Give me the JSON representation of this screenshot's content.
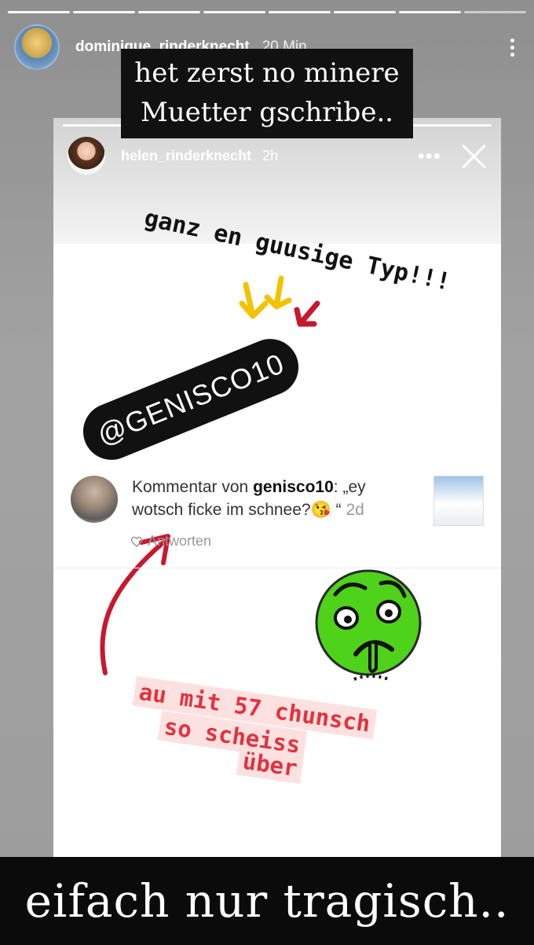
{
  "outer_story": {
    "username": "dominique_rinderknecht",
    "time": "20 Min.",
    "caption_top": "het zerst no minere Muetter gschribe..",
    "caption_bottom": "eifach nur tragisch.."
  },
  "inner_story": {
    "username": "helen_rinderknecht",
    "time": "2h",
    "more": "•••",
    "handwritten_top": "ganz en guusige Typ!!!",
    "tag": "@GENISCO10",
    "comment_prefix": "Kommentar von ",
    "comment_user": "genisco10",
    "comment_body_1": ": „ey",
    "comment_body_2": "wotsch ficke im schnee?😘",
    "comment_close": "“",
    "comment_time": "2d",
    "reply_label": "Antworten",
    "pink_line1": "au mit 57 chunsch",
    "pink_line2": "so scheiss",
    "pink_line3": "über"
  },
  "colors": {
    "arrow_yellow": "#f2c200",
    "arrow_red": "#c8182e",
    "emoji_green": "#4fd21a",
    "pink_text": "#e4323d",
    "pink_bg": "#fde1e1"
  },
  "icons": {
    "more_outer": "vertical-dots-icon",
    "close": "close-icon",
    "heart": "heart-icon",
    "sick_emoji": "nauseated-face-sticker"
  }
}
